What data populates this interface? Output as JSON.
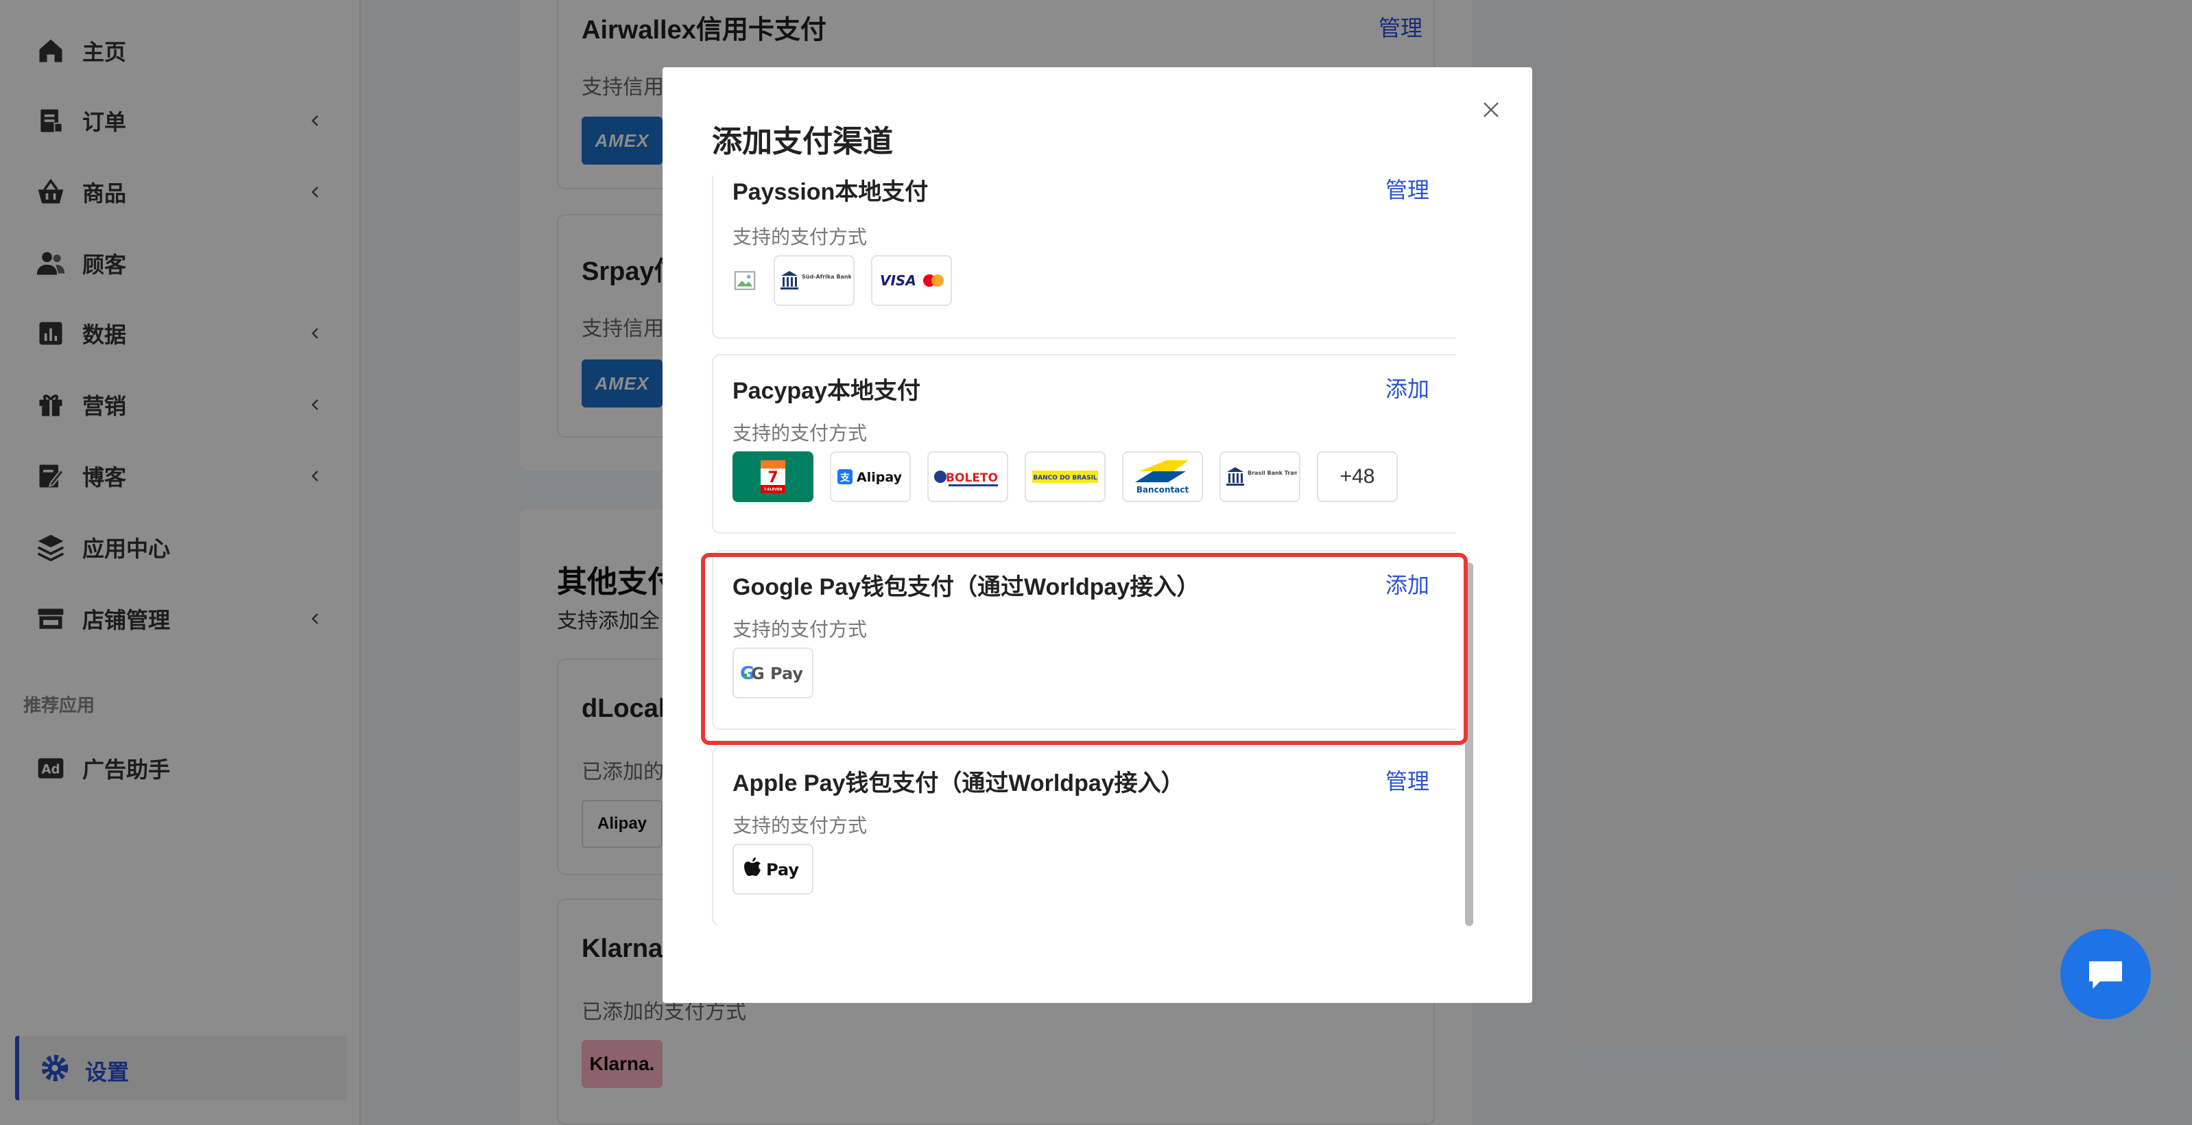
{
  "sidebar": {
    "items": [
      {
        "label": "主页",
        "icon": "home-icon",
        "chevron": false
      },
      {
        "label": "订单",
        "icon": "order-icon",
        "chevron": true
      },
      {
        "label": "商品",
        "icon": "basket-icon",
        "chevron": true
      },
      {
        "label": "顾客",
        "icon": "users-icon",
        "chevron": false
      },
      {
        "label": "数据",
        "icon": "chart-icon",
        "chevron": true
      },
      {
        "label": "营销",
        "icon": "gift-icon",
        "chevron": true
      },
      {
        "label": "博客",
        "icon": "edit-icon",
        "chevron": true
      },
      {
        "label": "应用中心",
        "icon": "layers-icon",
        "chevron": false
      },
      {
        "label": "店铺管理",
        "icon": "store-icon",
        "chevron": true
      }
    ],
    "section_title": "推荐应用",
    "recommended": {
      "label": "广告助手",
      "icon": "ad-icon"
    },
    "active": {
      "label": "设置",
      "icon": "gear-icon"
    }
  },
  "background": {
    "airwallex": {
      "title": "Airwallex信用卡支付",
      "sub": "支持信用",
      "action": "管理",
      "badge": "AMEX"
    },
    "srpay": {
      "title": "Srpay信",
      "sub": "支持信用",
      "badge": "AMEX"
    },
    "other_section": {
      "title": "其他支付",
      "sub": "支持添加全"
    },
    "dlocal": {
      "title": "dLocal",
      "sub": "已添加的",
      "badge": "Alipay"
    },
    "klarna": {
      "title": "Klarna",
      "sub": "已添加的支付方式",
      "badge": "Klarna."
    }
  },
  "modal": {
    "title": "添加支付渠道",
    "cards": [
      {
        "title": "Payssion本地支付",
        "action": "管理",
        "sub": "支持的支付方式",
        "methods": [
          "Süd-Afrika Bank Transfer",
          "VISA"
        ]
      },
      {
        "title": "Pacypay本地支付",
        "action": "添加",
        "sub": "支持的支付方式",
        "methods": [
          "7-ELEVEN",
          "Alipay",
          "BOLETO",
          "BANCO DO BRASIL",
          "Bancontact",
          "Brasil Bank Transfer"
        ],
        "more": "+48"
      },
      {
        "title": "Google Pay钱包支付（通过Worldpay接入）",
        "action": "添加",
        "sub": "支持的支付方式",
        "methods": [
          "G Pay"
        ]
      },
      {
        "title": "Apple Pay钱包支付（通过Worldpay接入）",
        "action": "管理",
        "sub": "支持的支付方式",
        "methods": [
          "Pay"
        ]
      }
    ]
  },
  "colors": {
    "accent": "#2b51d4",
    "highlight": "#e53935",
    "chat": "#1e74e6"
  }
}
